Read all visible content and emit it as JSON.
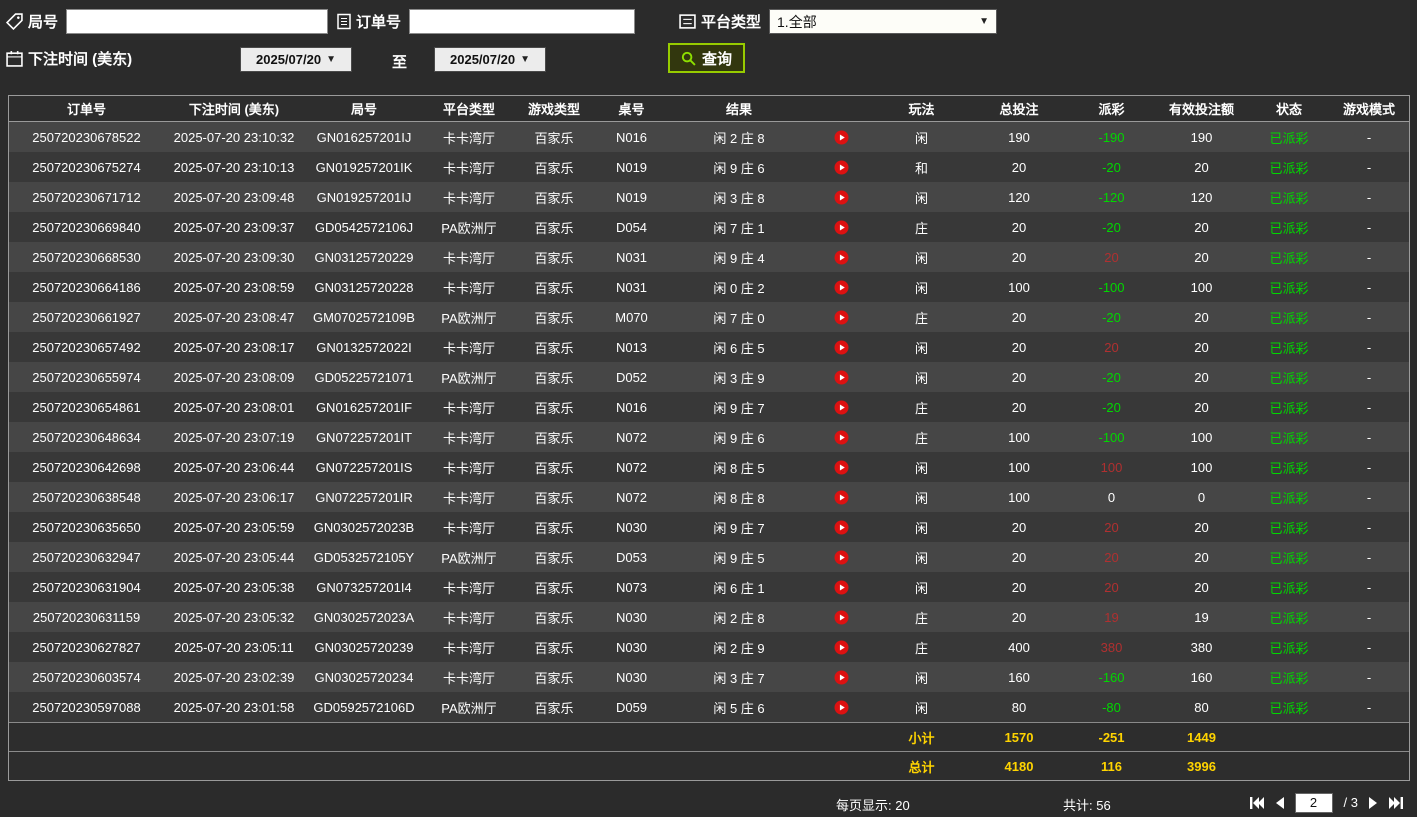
{
  "filters": {
    "round_label": "局号",
    "round_value": "",
    "order_label": "订单号",
    "order_value": "",
    "platform_label": "平台类型",
    "platform_value": "1.全部",
    "bet_time_label": "下注时间 (美东)",
    "date_from": "2025/07/20",
    "to_label": "至",
    "date_to": "2025/07/20",
    "search_label": "查询"
  },
  "icons": {
    "round": "tag-icon",
    "order": "document-icon",
    "platform": "list-icon",
    "bet_time": "calendar-icon",
    "search": "search-icon",
    "row_media": "play-icon"
  },
  "colors": {
    "accent_green_border": "#97cc00",
    "payout_negative_green": "#00d800",
    "payout_positive_red": "#b03030",
    "status_paid_green": "#00d800",
    "summary_yellow": "#ffd400",
    "play_button_red": "#dd1111"
  },
  "table": {
    "headers": [
      "订单号",
      "下注时间 (美东)",
      "局号",
      "平台类型",
      "游戏类型",
      "桌号",
      "结果",
      "",
      "玩法",
      "总投注",
      "派彩",
      "有效投注额",
      "状态",
      "游戏模式"
    ],
    "rows": [
      {
        "order_id": "250720230678522",
        "bet_time": "2025-07-20 23:10:32",
        "round_id": "GN016257201IJ",
        "platform": "卡卡湾厅",
        "game_type": "百家乐",
        "table_no": "N016",
        "result": "闲 2 庄 8",
        "play_type": "闲",
        "total_bet": "190",
        "payout": "-190",
        "payout_class": "green",
        "valid_bet": "190",
        "status": "已派彩",
        "mode": "-"
      },
      {
        "order_id": "250720230675274",
        "bet_time": "2025-07-20 23:10:13",
        "round_id": "GN019257201IK",
        "platform": "卡卡湾厅",
        "game_type": "百家乐",
        "table_no": "N019",
        "result": "闲 9 庄 6",
        "play_type": "和",
        "total_bet": "20",
        "payout": "-20",
        "payout_class": "green",
        "valid_bet": "20",
        "status": "已派彩",
        "mode": "-"
      },
      {
        "order_id": "250720230671712",
        "bet_time": "2025-07-20 23:09:48",
        "round_id": "GN019257201IJ",
        "platform": "卡卡湾厅",
        "game_type": "百家乐",
        "table_no": "N019",
        "result": "闲 3 庄 8",
        "play_type": "闲",
        "total_bet": "120",
        "payout": "-120",
        "payout_class": "green",
        "valid_bet": "120",
        "status": "已派彩",
        "mode": "-"
      },
      {
        "order_id": "250720230669840",
        "bet_time": "2025-07-20 23:09:37",
        "round_id": "GD0542572106J",
        "platform": "PA欧洲厅",
        "game_type": "百家乐",
        "table_no": "D054",
        "result": "闲 7 庄 1",
        "play_type": "庄",
        "total_bet": "20",
        "payout": "-20",
        "payout_class": "green",
        "valid_bet": "20",
        "status": "已派彩",
        "mode": "-"
      },
      {
        "order_id": "250720230668530",
        "bet_time": "2025-07-20 23:09:30",
        "round_id": "GN03125720229",
        "platform": "卡卡湾厅",
        "game_type": "百家乐",
        "table_no": "N031",
        "result": "闲 9 庄 4",
        "play_type": "闲",
        "total_bet": "20",
        "payout": "20",
        "payout_class": "red",
        "valid_bet": "20",
        "status": "已派彩",
        "mode": "-"
      },
      {
        "order_id": "250720230664186",
        "bet_time": "2025-07-20 23:08:59",
        "round_id": "GN03125720228",
        "platform": "卡卡湾厅",
        "game_type": "百家乐",
        "table_no": "N031",
        "result": "闲 0 庄 2",
        "play_type": "闲",
        "total_bet": "100",
        "payout": "-100",
        "payout_class": "green",
        "valid_bet": "100",
        "status": "已派彩",
        "mode": "-"
      },
      {
        "order_id": "250720230661927",
        "bet_time": "2025-07-20 23:08:47",
        "round_id": "GM0702572109B",
        "platform": "PA欧洲厅",
        "game_type": "百家乐",
        "table_no": "M070",
        "result": "闲 7 庄 0",
        "play_type": "庄",
        "total_bet": "20",
        "payout": "-20",
        "payout_class": "green",
        "valid_bet": "20",
        "status": "已派彩",
        "mode": "-"
      },
      {
        "order_id": "250720230657492",
        "bet_time": "2025-07-20 23:08:17",
        "round_id": "GN0132572022I",
        "platform": "卡卡湾厅",
        "game_type": "百家乐",
        "table_no": "N013",
        "result": "闲 6 庄 5",
        "play_type": "闲",
        "total_bet": "20",
        "payout": "20",
        "payout_class": "red",
        "valid_bet": "20",
        "status": "已派彩",
        "mode": "-"
      },
      {
        "order_id": "250720230655974",
        "bet_time": "2025-07-20 23:08:09",
        "round_id": "GD05225721071",
        "platform": "PA欧洲厅",
        "game_type": "百家乐",
        "table_no": "D052",
        "result": "闲 3 庄 9",
        "play_type": "闲",
        "total_bet": "20",
        "payout": "-20",
        "payout_class": "green",
        "valid_bet": "20",
        "status": "已派彩",
        "mode": "-"
      },
      {
        "order_id": "250720230654861",
        "bet_time": "2025-07-20 23:08:01",
        "round_id": "GN016257201IF",
        "platform": "卡卡湾厅",
        "game_type": "百家乐",
        "table_no": "N016",
        "result": "闲 9 庄 7",
        "play_type": "庄",
        "total_bet": "20",
        "payout": "-20",
        "payout_class": "green",
        "valid_bet": "20",
        "status": "已派彩",
        "mode": "-"
      },
      {
        "order_id": "250720230648634",
        "bet_time": "2025-07-20 23:07:19",
        "round_id": "GN072257201IT",
        "platform": "卡卡湾厅",
        "game_type": "百家乐",
        "table_no": "N072",
        "result": "闲 9 庄 6",
        "play_type": "庄",
        "total_bet": "100",
        "payout": "-100",
        "payout_class": "green",
        "valid_bet": "100",
        "status": "已派彩",
        "mode": "-"
      },
      {
        "order_id": "250720230642698",
        "bet_time": "2025-07-20 23:06:44",
        "round_id": "GN072257201IS",
        "platform": "卡卡湾厅",
        "game_type": "百家乐",
        "table_no": "N072",
        "result": "闲 8 庄 5",
        "play_type": "闲",
        "total_bet": "100",
        "payout": "100",
        "payout_class": "red",
        "valid_bet": "100",
        "status": "已派彩",
        "mode": "-"
      },
      {
        "order_id": "250720230638548",
        "bet_time": "2025-07-20 23:06:17",
        "round_id": "GN072257201IR",
        "platform": "卡卡湾厅",
        "game_type": "百家乐",
        "table_no": "N072",
        "result": "闲 8 庄 8",
        "play_type": "闲",
        "total_bet": "100",
        "payout": "0",
        "payout_class": "white",
        "valid_bet": "0",
        "status": "已派彩",
        "mode": "-"
      },
      {
        "order_id": "250720230635650",
        "bet_time": "2025-07-20 23:05:59",
        "round_id": "GN0302572023B",
        "platform": "卡卡湾厅",
        "game_type": "百家乐",
        "table_no": "N030",
        "result": "闲 9 庄 7",
        "play_type": "闲",
        "total_bet": "20",
        "payout": "20",
        "payout_class": "red",
        "valid_bet": "20",
        "status": "已派彩",
        "mode": "-"
      },
      {
        "order_id": "250720230632947",
        "bet_time": "2025-07-20 23:05:44",
        "round_id": "GD0532572105Y",
        "platform": "PA欧洲厅",
        "game_type": "百家乐",
        "table_no": "D053",
        "result": "闲 9 庄 5",
        "play_type": "闲",
        "total_bet": "20",
        "payout": "20",
        "payout_class": "red",
        "valid_bet": "20",
        "status": "已派彩",
        "mode": "-"
      },
      {
        "order_id": "250720230631904",
        "bet_time": "2025-07-20 23:05:38",
        "round_id": "GN073257201I4",
        "platform": "卡卡湾厅",
        "game_type": "百家乐",
        "table_no": "N073",
        "result": "闲 6 庄 1",
        "play_type": "闲",
        "total_bet": "20",
        "payout": "20",
        "payout_class": "red",
        "valid_bet": "20",
        "status": "已派彩",
        "mode": "-"
      },
      {
        "order_id": "250720230631159",
        "bet_time": "2025-07-20 23:05:32",
        "round_id": "GN0302572023A",
        "platform": "卡卡湾厅",
        "game_type": "百家乐",
        "table_no": "N030",
        "result": "闲 2 庄 8",
        "play_type": "庄",
        "total_bet": "20",
        "payout": "19",
        "payout_class": "red",
        "valid_bet": "19",
        "status": "已派彩",
        "mode": "-"
      },
      {
        "order_id": "250720230627827",
        "bet_time": "2025-07-20 23:05:11",
        "round_id": "GN03025720239",
        "platform": "卡卡湾厅",
        "game_type": "百家乐",
        "table_no": "N030",
        "result": "闲 2 庄 9",
        "play_type": "庄",
        "total_bet": "400",
        "payout": "380",
        "payout_class": "red",
        "valid_bet": "380",
        "status": "已派彩",
        "mode": "-"
      },
      {
        "order_id": "250720230603574",
        "bet_time": "2025-07-20 23:02:39",
        "round_id": "GN03025720234",
        "platform": "卡卡湾厅",
        "game_type": "百家乐",
        "table_no": "N030",
        "result": "闲 3 庄 7",
        "play_type": "闲",
        "total_bet": "160",
        "payout": "-160",
        "payout_class": "green",
        "valid_bet": "160",
        "status": "已派彩",
        "mode": "-"
      },
      {
        "order_id": "250720230597088",
        "bet_time": "2025-07-20 23:01:58",
        "round_id": "GD0592572106D",
        "platform": "PA欧洲厅",
        "game_type": "百家乐",
        "table_no": "D059",
        "result": "闲 5 庄 6",
        "play_type": "闲",
        "total_bet": "80",
        "payout": "-80",
        "payout_class": "green",
        "valid_bet": "80",
        "status": "已派彩",
        "mode": "-"
      }
    ],
    "subtotal": {
      "label": "小计",
      "total_bet": "1570",
      "payout": "-251",
      "valid_bet": "1449"
    },
    "total": {
      "label": "总计",
      "total_bet": "4180",
      "payout": "116",
      "valid_bet": "3996"
    }
  },
  "pagination": {
    "per_page_label": "每页显示: 20",
    "total_label": "共计: 56",
    "current_page": "2",
    "total_pages_label": "/ 3"
  }
}
